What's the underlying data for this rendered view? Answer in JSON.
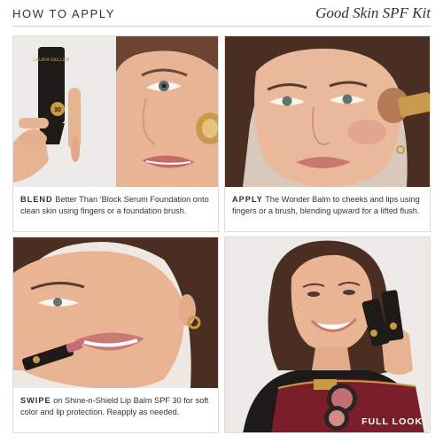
{
  "header": {
    "title": "HOW TO APPLY",
    "kit_name": "Good Skin SPF Kit"
  },
  "steps": [
    {
      "keyword": "BLEND",
      "text": "Better Than ‘Block Serum Foundation onto clean skin using fingers or a foundation brush.",
      "product_label": "LAURA GELLER",
      "product_badge": "30"
    },
    {
      "keyword": "APPLY",
      "text": "The Wonder Balm to cheeks and lips using fingers or a brush, blending upward for a lifted flush."
    },
    {
      "keyword": "SWIPE",
      "text": "on Shine-n-Shield Lip Balm SPF 30 for soft color and lip protection. Reapply as needed."
    }
  ],
  "final": {
    "label": "FULL LOOK"
  },
  "colors": {
    "skin": "#e9b89a",
    "hair": "#4a2e22",
    "accent_gold": "#c79a45",
    "bag": "#7a1f2a",
    "product_dark": "#1e1a17"
  }
}
